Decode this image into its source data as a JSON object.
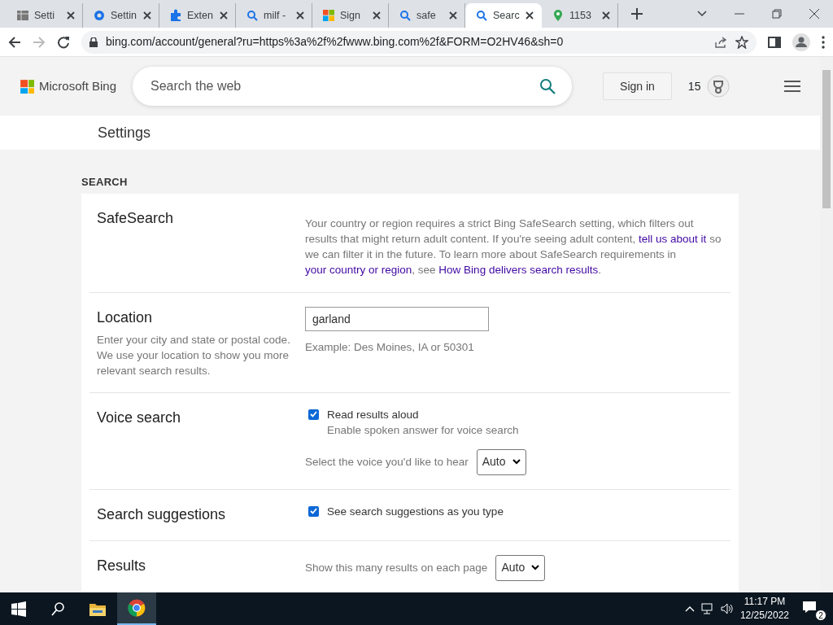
{
  "browser": {
    "tabs": [
      {
        "title": "Setti",
        "kind": "sheet",
        "selected": false
      },
      {
        "title": "Settin",
        "kind": "gear",
        "selected": false
      },
      {
        "title": "Exten",
        "kind": "puzzle",
        "selected": false
      },
      {
        "title": "milf -",
        "kind": "search",
        "selected": false
      },
      {
        "title": "Sign",
        "kind": "squares",
        "selected": false
      },
      {
        "title": "safe",
        "kind": "search",
        "selected": false
      },
      {
        "title": "Searc",
        "kind": "search",
        "selected": true
      },
      {
        "title": "1153",
        "kind": "pin",
        "selected": false
      }
    ],
    "url": "bing.com/account/general?ru=https%3a%2f%2fwww.bing.com%2f&FORM=O2HV46&sh=0"
  },
  "header": {
    "logo": "Microsoft Bing",
    "search": {
      "placeholder": "Search the web"
    },
    "sign_in": "Sign in",
    "points": "15"
  },
  "page_title": "Settings",
  "section_title": "SEARCH",
  "settings": [
    {
      "kind": "text",
      "title": "SafeSearch",
      "parts": [
        {
          "text": "Your country or region requires a strict Bing SafeSearch setting, which filters out results that might return adult content. If you're seeing adult content, ",
          "link": false
        },
        {
          "text": "tell us about it",
          "link": true
        },
        {
          "text": " so we can filter it in the future. To learn more about SafeSearch requirements in ",
          "link": false
        },
        {
          "text": "your country or region",
          "link": true
        },
        {
          "text": ", see ",
          "link": false
        },
        {
          "text": "How Bing delivers search results",
          "link": true
        },
        {
          "text": ".",
          "link": false
        }
      ]
    },
    {
      "kind": "location",
      "title": "Location",
      "description": "Enter your city and state or postal code. We use your location to show you more relevant search results.",
      "value": "garland",
      "hint": "Example: Des Moines, IA or 50301"
    },
    {
      "kind": "voice",
      "title": "Voice search",
      "checkbox": {
        "label": "Read results aloud",
        "sub": "Enable spoken answer for voice search",
        "checked": true
      },
      "select_label": "Select the voice you'd like to hear",
      "select_value": "Auto"
    },
    {
      "kind": "checkbox",
      "title": "Search suggestions",
      "checkbox": {
        "label": "See search suggestions as you type",
        "checked": true
      }
    },
    {
      "kind": "select",
      "title": "Results",
      "select_label": "Show this many results on each page",
      "select_value": "Auto"
    }
  ],
  "taskbar": {
    "time": "11:17 PM",
    "date": "12/25/2022",
    "notifications": "2"
  }
}
